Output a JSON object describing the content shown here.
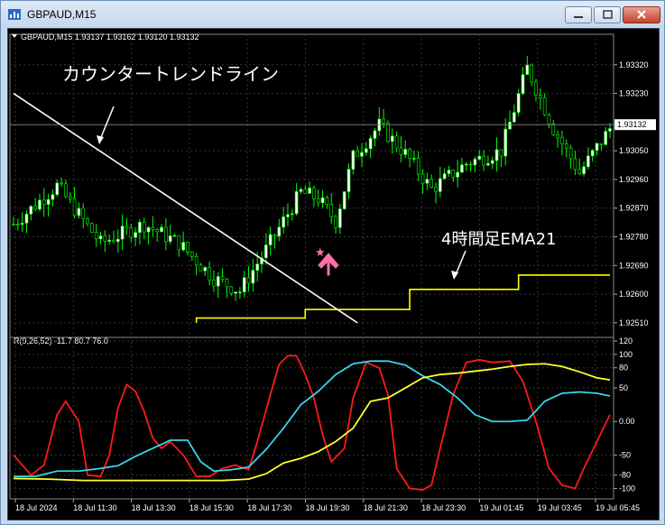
{
  "window": {
    "title": "GBPAUD,M15",
    "buttons": {
      "minimize": "minimize",
      "maximize": "maximize",
      "close": "close"
    }
  },
  "chart_data": [
    {
      "type": "candlestick",
      "symbol_info": "GBPAUD,M15  1.93137 1.93162 1.93120 1.93132",
      "ylim": [
        1.9247,
        1.9341
      ],
      "y_ticks": [
        "1.93320",
        "1.93230",
        "1.93050",
        "1.92960",
        "1.92870",
        "1.92780",
        "1.92690",
        "1.92600",
        "1.92510"
      ],
      "current_price": "1.93132",
      "colors": {
        "up": "#ffffff",
        "down": "#000000",
        "wick": "#00ff00",
        "ema": "#ffff00",
        "trendline": "#ffffff",
        "arrow": "#ff6fa8",
        "grid": "#2e3b2e",
        "axis_text": "#ffffff",
        "bg": "#000000"
      },
      "grid": true,
      "candle_count": 138,
      "trend_turning_points": [
        [
          0,
          1.9282
        ],
        [
          10,
          1.9294
        ],
        [
          20,
          1.9276
        ],
        [
          30,
          1.9282
        ],
        [
          38,
          1.9276
        ],
        [
          46,
          1.9265
        ],
        [
          52,
          1.9261
        ],
        [
          58,
          1.9274
        ],
        [
          66,
          1.9292
        ],
        [
          70,
          1.929
        ],
        [
          74,
          1.9283
        ],
        [
          78,
          1.9303
        ],
        [
          84,
          1.9313
        ],
        [
          90,
          1.9304
        ],
        [
          96,
          1.9293
        ],
        [
          104,
          1.9301
        ],
        [
          112,
          1.9305
        ],
        [
          118,
          1.9331
        ],
        [
          124,
          1.9312
        ],
        [
          130,
          1.9298
        ],
        [
          137,
          1.9312
        ]
      ],
      "ema_h4": [
        [
          42,
          1.9251
        ],
        [
          42,
          1.92525
        ],
        [
          67,
          1.92525
        ],
        [
          67,
          1.92552
        ],
        [
          91,
          1.92552
        ],
        [
          91,
          1.92615
        ],
        [
          116,
          1.92615
        ],
        [
          116,
          1.9266
        ],
        [
          137,
          1.9266
        ]
      ],
      "trendline": [
        [
          0,
          1.9323
        ],
        [
          79,
          1.9251
        ]
      ],
      "annotations": {
        "countertrend": "カウンタートレンドライン",
        "ema": "4時間足EMA21"
      }
    },
    {
      "type": "line",
      "indicator_label": "R(9,26,52) -11.7 80.7 76.0",
      "ylim": [
        -110,
        120
      ],
      "y_ticks": [
        "120",
        "100",
        "80",
        "50",
        "0.00",
        "-50",
        "-80",
        "-100"
      ],
      "series": [
        {
          "color": "#ff1a1a",
          "points": [
            [
              0,
              -50
            ],
            [
              4,
              -80
            ],
            [
              7,
              -65
            ],
            [
              10,
              10
            ],
            [
              12,
              30
            ],
            [
              15,
              0
            ],
            [
              17,
              -80
            ],
            [
              20,
              -82
            ],
            [
              22,
              -50
            ],
            [
              24,
              20
            ],
            [
              26,
              55
            ],
            [
              28,
              45
            ],
            [
              30,
              15
            ],
            [
              32,
              -25
            ],
            [
              34,
              -40
            ],
            [
              36,
              -30
            ],
            [
              39,
              -50
            ],
            [
              42,
              -82
            ],
            [
              45,
              -82
            ],
            [
              48,
              -70
            ],
            [
              51,
              -65
            ],
            [
              54,
              -72
            ],
            [
              56,
              -30
            ],
            [
              59,
              40
            ],
            [
              61,
              85
            ],
            [
              63,
              98
            ],
            [
              65,
              98
            ],
            [
              67,
              70
            ],
            [
              69,
              35
            ],
            [
              71,
              -20
            ],
            [
              73,
              -60
            ],
            [
              76,
              -40
            ],
            [
              78,
              35
            ],
            [
              81,
              88
            ],
            [
              84,
              80
            ],
            [
              86,
              40
            ],
            [
              88,
              -70
            ],
            [
              91,
              -100
            ],
            [
              94,
              -102
            ],
            [
              96,
              -95
            ],
            [
              98,
              -40
            ],
            [
              101,
              40
            ],
            [
              104,
              88
            ],
            [
              107,
              92
            ],
            [
              110,
              88
            ],
            [
              114,
              90
            ],
            [
              117,
              60
            ],
            [
              120,
              0
            ],
            [
              123,
              -70
            ],
            [
              126,
              -95
            ],
            [
              129,
              -100
            ],
            [
              131,
              -70
            ],
            [
              134,
              -30
            ],
            [
              137,
              10
            ]
          ]
        },
        {
          "color": "#39d4e6",
          "points": [
            [
              0,
              -82
            ],
            [
              5,
              -82
            ],
            [
              10,
              -74
            ],
            [
              15,
              -74
            ],
            [
              20,
              -70
            ],
            [
              24,
              -66
            ],
            [
              28,
              -52
            ],
            [
              32,
              -40
            ],
            [
              36,
              -28
            ],
            [
              40,
              -28
            ],
            [
              43,
              -60
            ],
            [
              46,
              -74
            ],
            [
              50,
              -72
            ],
            [
              54,
              -68
            ],
            [
              58,
              -42
            ],
            [
              62,
              -10
            ],
            [
              66,
              25
            ],
            [
              70,
              45
            ],
            [
              74,
              70
            ],
            [
              78,
              86
            ],
            [
              82,
              90
            ],
            [
              86,
              90
            ],
            [
              90,
              84
            ],
            [
              94,
              68
            ],
            [
              98,
              55
            ],
            [
              102,
              35
            ],
            [
              106,
              10
            ],
            [
              110,
              0
            ],
            [
              114,
              0
            ],
            [
              118,
              2
            ],
            [
              122,
              30
            ],
            [
              126,
              42
            ],
            [
              130,
              44
            ],
            [
              134,
              42
            ],
            [
              137,
              38
            ]
          ]
        },
        {
          "color": "#ffff2e",
          "points": [
            [
              0,
              -85
            ],
            [
              8,
              -86
            ],
            [
              16,
              -88
            ],
            [
              24,
              -88
            ],
            [
              32,
              -88
            ],
            [
              40,
              -88
            ],
            [
              48,
              -88
            ],
            [
              54,
              -86
            ],
            [
              58,
              -78
            ],
            [
              62,
              -62
            ],
            [
              66,
              -55
            ],
            [
              70,
              -45
            ],
            [
              74,
              -30
            ],
            [
              78,
              -10
            ],
            [
              82,
              30
            ],
            [
              86,
              35
            ],
            [
              90,
              50
            ],
            [
              94,
              65
            ],
            [
              98,
              70
            ],
            [
              102,
              72
            ],
            [
              106,
              75
            ],
            [
              110,
              78
            ],
            [
              114,
              82
            ],
            [
              118,
              85
            ],
            [
              122,
              86
            ],
            [
              126,
              82
            ],
            [
              130,
              74
            ],
            [
              134,
              65
            ],
            [
              137,
              62
            ]
          ]
        }
      ]
    }
  ],
  "x_ticks": [
    "18 Jul 2024",
    "18 Jul 11:30",
    "18 Jul 13:30",
    "18 Jul 15:30",
    "18 Jul 17:30",
    "18 Jul 19:30",
    "18 Jul 21:30",
    "18 Jul 23:30",
    "19 Jul 01:45",
    "19 Jul 03:45",
    "19 Jul 05:45"
  ]
}
